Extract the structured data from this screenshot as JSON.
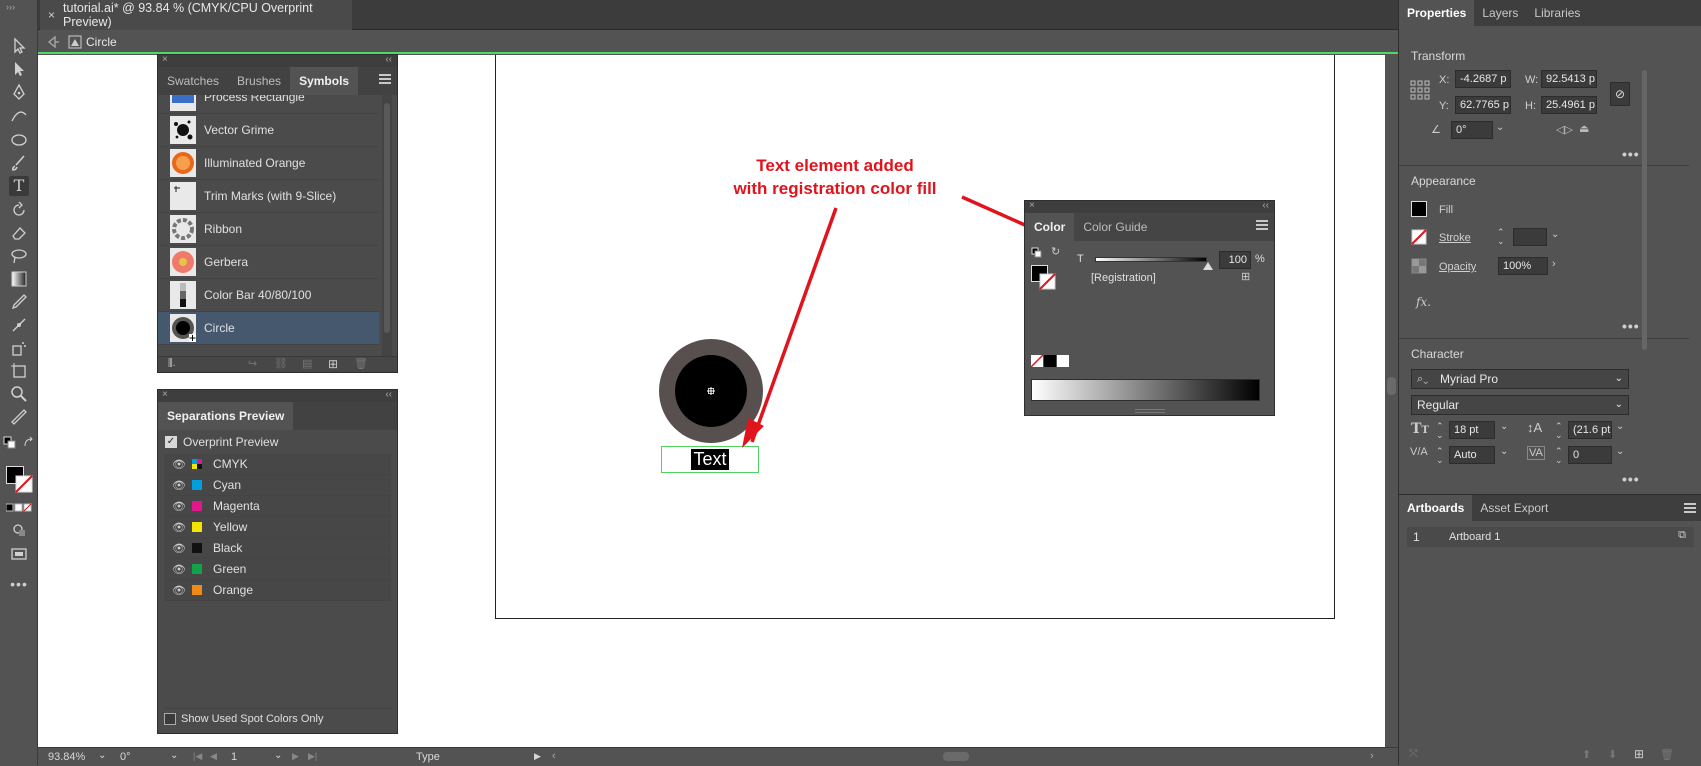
{
  "document": {
    "tab_title": "tutorial.ai* @ 93.84 % (CMYK/CPU Overprint Preview)",
    "close_glyph": "×"
  },
  "breadcrumb": {
    "label": "Circle"
  },
  "symbols_panel": {
    "tabs": [
      "Swatches",
      "Brushes",
      "Symbols"
    ],
    "active_tab": "Symbols",
    "items": [
      {
        "label": "Process Rectangle"
      },
      {
        "label": "Vector Grime"
      },
      {
        "label": "Illuminated Orange"
      },
      {
        "label": "Trim Marks (with 9-Slice)"
      },
      {
        "label": "Ribbon"
      },
      {
        "label": "Gerbera"
      },
      {
        "label": "Color Bar 40/80/100"
      },
      {
        "label": "Circle",
        "selected": true
      }
    ]
  },
  "separations_panel": {
    "title": "Separations Preview",
    "overprint_label": "Overprint Preview",
    "overprint_checked": true,
    "rows": [
      {
        "label": "CMYK",
        "color": "cmyk"
      },
      {
        "label": "Cyan",
        "color": "#00a0e0"
      },
      {
        "label": "Magenta",
        "color": "#e0188c"
      },
      {
        "label": "Yellow",
        "color": "#f5e400"
      },
      {
        "label": "Black",
        "color": "#111111"
      },
      {
        "label": "Green",
        "color": "#12a24a"
      },
      {
        "label": "Orange",
        "color": "#f08a14"
      }
    ],
    "spot_only_label": "Show Used Spot Colors Only"
  },
  "color_panel": {
    "tabs": [
      "Color",
      "Color Guide"
    ],
    "active_tab": "Color",
    "slider_label": "T",
    "value": "100",
    "unit": "%",
    "color_name": "[Registration]"
  },
  "annotation": {
    "line1": "Text element added",
    "line2": "with registration color fill",
    "color": "#e0141d"
  },
  "canvas_text": {
    "label": "Text"
  },
  "properties": {
    "tabs": [
      "Properties",
      "Layers",
      "Libraries"
    ],
    "active_tab": "Properties",
    "transform": {
      "title": "Transform",
      "x_label": "X:",
      "x_value": "-4.2687 p",
      "y_label": "Y:",
      "y_value": "62.7765 p",
      "w_label": "W:",
      "w_value": "92.5413 p",
      "h_label": "H:",
      "h_value": "25.4961 p",
      "angle": "0°"
    },
    "appearance": {
      "title": "Appearance",
      "fill_label": "Fill",
      "stroke_label": "Stroke",
      "opacity_label": "Opacity",
      "opacity_value": "100%",
      "fx_label": "fx."
    },
    "character": {
      "title": "Character",
      "font_family": "Myriad Pro",
      "font_style": "Regular",
      "font_size": "18 pt",
      "leading": "(21.6 pt",
      "kerning": "Auto",
      "tracking": "0"
    }
  },
  "artboards_panel": {
    "tabs": [
      "Artboards",
      "Asset Export"
    ],
    "active_tab": "Artboards",
    "rows": [
      {
        "index": "1",
        "name": "Artboard 1"
      }
    ]
  },
  "status_bar": {
    "zoom": "93.84%",
    "rotation": "0°",
    "artboard_num": "1",
    "tool": "Type"
  }
}
